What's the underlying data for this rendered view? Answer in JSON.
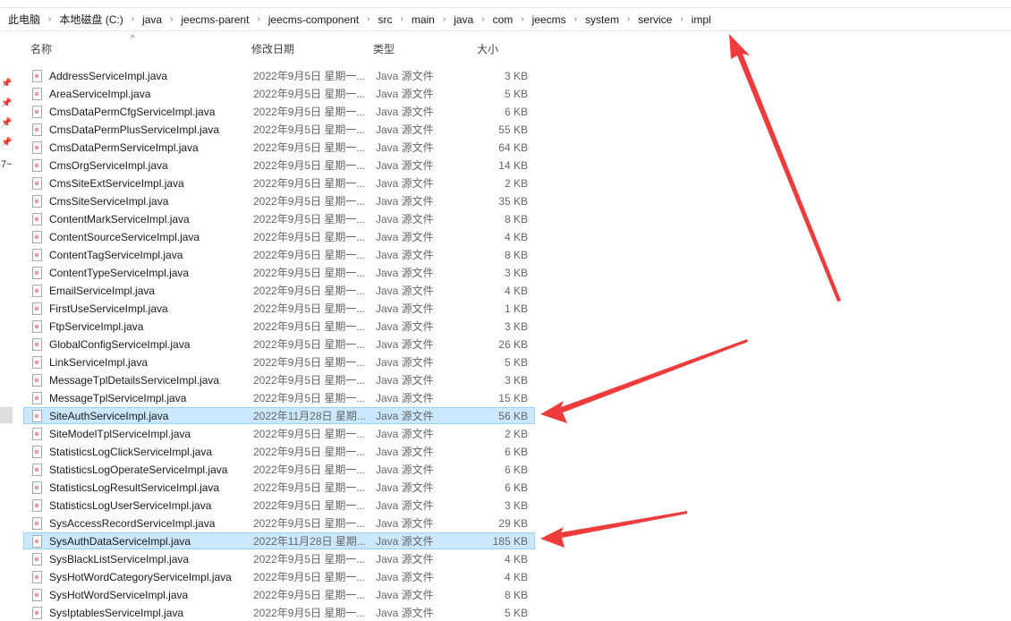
{
  "breadcrumb": [
    "此电脑",
    "本地磁盘 (C:)",
    "java",
    "jeecms-parent",
    "jeecms-component",
    "src",
    "main",
    "java",
    "com",
    "jeecms",
    "system",
    "service",
    "impl"
  ],
  "columns": {
    "name": "名称",
    "date": "修改日期",
    "type": "类型",
    "size": "大小"
  },
  "left_label": "7~",
  "files": [
    [
      "AddressServiceImpl.java",
      "2022年9月5日 星期一...",
      "Java 源文件",
      "3 KB"
    ],
    [
      "AreaServiceImpl.java",
      "2022年9月5日 星期一...",
      "Java 源文件",
      "5 KB"
    ],
    [
      "CmsDataPermCfgServiceImpl.java",
      "2022年9月5日 星期一...",
      "Java 源文件",
      "6 KB"
    ],
    [
      "CmsDataPermPlusServiceImpl.java",
      "2022年9月5日 星期一...",
      "Java 源文件",
      "55 KB"
    ],
    [
      "CmsDataPermServiceImpl.java",
      "2022年9月5日 星期一...",
      "Java 源文件",
      "64 KB"
    ],
    [
      "CmsOrgServiceImpl.java",
      "2022年9月5日 星期一...",
      "Java 源文件",
      "14 KB"
    ],
    [
      "CmsSiteExtServiceImpl.java",
      "2022年9月5日 星期一...",
      "Java 源文件",
      "2 KB"
    ],
    [
      "CmsSiteServiceImpl.java",
      "2022年9月5日 星期一...",
      "Java 源文件",
      "35 KB"
    ],
    [
      "ContentMarkServiceImpl.java",
      "2022年9月5日 星期一...",
      "Java 源文件",
      "8 KB"
    ],
    [
      "ContentSourceServiceImpl.java",
      "2022年9月5日 星期一...",
      "Java 源文件",
      "4 KB"
    ],
    [
      "ContentTagServiceImpl.java",
      "2022年9月5日 星期一...",
      "Java 源文件",
      "8 KB"
    ],
    [
      "ContentTypeServiceImpl.java",
      "2022年9月5日 星期一...",
      "Java 源文件",
      "3 KB"
    ],
    [
      "EmailServiceImpl.java",
      "2022年9月5日 星期一...",
      "Java 源文件",
      "4 KB"
    ],
    [
      "FirstUseServiceImpl.java",
      "2022年9月5日 星期一...",
      "Java 源文件",
      "1 KB"
    ],
    [
      "FtpServiceImpl.java",
      "2022年9月5日 星期一...",
      "Java 源文件",
      "3 KB"
    ],
    [
      "GlobalConfigServiceImpl.java",
      "2022年9月5日 星期一...",
      "Java 源文件",
      "26 KB"
    ],
    [
      "LinkServiceImpl.java",
      "2022年9月5日 星期一...",
      "Java 源文件",
      "5 KB"
    ],
    [
      "MessageTplDetailsServiceImpl.java",
      "2022年9月5日 星期一...",
      "Java 源文件",
      "3 KB"
    ],
    [
      "MessageTplServiceImpl.java",
      "2022年9月5日 星期一...",
      "Java 源文件",
      "15 KB"
    ],
    [
      "SiteAuthServiceImpl.java",
      "2022年11月28日 星期...",
      "Java 源文件",
      "56 KB"
    ],
    [
      "SiteModelTplServiceImpl.java",
      "2022年9月5日 星期一...",
      "Java 源文件",
      "2 KB"
    ],
    [
      "StatisticsLogClickServiceImpl.java",
      "2022年9月5日 星期一...",
      "Java 源文件",
      "6 KB"
    ],
    [
      "StatisticsLogOperateServiceImpl.java",
      "2022年9月5日 星期一...",
      "Java 源文件",
      "6 KB"
    ],
    [
      "StatisticsLogResultServiceImpl.java",
      "2022年9月5日 星期一...",
      "Java 源文件",
      "6 KB"
    ],
    [
      "StatisticsLogUserServiceImpl.java",
      "2022年9月5日 星期一...",
      "Java 源文件",
      "3 KB"
    ],
    [
      "SysAccessRecordServiceImpl.java",
      "2022年9月5日 星期一...",
      "Java 源文件",
      "29 KB"
    ],
    [
      "SysAuthDataServiceImpl.java",
      "2022年11月28日 星期...",
      "Java 源文件",
      "185 KB"
    ],
    [
      "SysBlackListServiceImpl.java",
      "2022年9月5日 星期一...",
      "Java 源文件",
      "4 KB"
    ],
    [
      "SysHotWordCategoryServiceImpl.java",
      "2022年9月5日 星期一...",
      "Java 源文件",
      "4 KB"
    ],
    [
      "SysHotWordServiceImpl.java",
      "2022年9月5日 星期一...",
      "Java 源文件",
      "8 KB"
    ],
    [
      "SysIptablesServiceImpl.java",
      "2022年9月5日 星期一...",
      "Java 源文件",
      "5 KB"
    ]
  ],
  "highlighted": [
    19,
    26
  ],
  "annotation_color": "#ee3b3b"
}
